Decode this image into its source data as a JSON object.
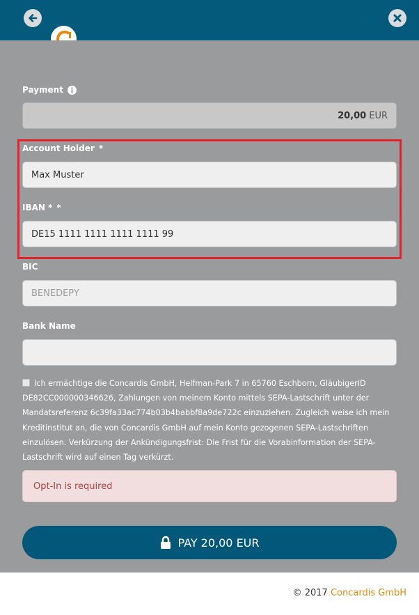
{
  "header": {
    "back_icon": "arrow-left-icon",
    "close_icon": "close-x-icon",
    "logo_icon": "concardis-logo-icon",
    "colors": {
      "header_bg": "#035a7a",
      "logo_accent": "#e58a0f"
    }
  },
  "form": {
    "payment_label": "Payment",
    "payment_amount": "20,00",
    "payment_currency": "EUR",
    "account_holder_label": "Account Holder",
    "account_holder_required": "*",
    "account_holder_value": "Max Muster",
    "iban_label": "IBAN *",
    "iban_required": "*",
    "iban_value": "DE15 1111 1111 1111 1111 99",
    "bic_label": "BIC",
    "bic_placeholder": "BENEDEPY",
    "bank_name_label": "Bank Name",
    "bank_name_value": ""
  },
  "consent": {
    "checked": false,
    "text": "Ich ermächtige die Concardis GmbH, Helfman-Park 7 in 65760 Eschborn, GläubigerID DE82CC000000346626, Zahlungen von meinem Konto mittels SEPA-Lastschrift unter der Mandatsreferenz 6c39fa33ac774b03b4babbf8a9de722c einzuziehen. Zugleich weise ich mein Kreditinstitut an, die von Concardis GmbH auf mein Konto gezogenen SEPA-Lastschriften einzulösen. Verkürzung der Ankündigungsfrist: Die Frist für die Vorabinformation der SEPA-Lastschrift wird auf einen Tag verkürzt."
  },
  "error": {
    "message": "Opt-In is required",
    "color": "#a94442"
  },
  "pay_button": {
    "label": "PAY 20,00 EUR",
    "icon": "lock-icon",
    "color": "#03587a"
  },
  "footer": {
    "copyright": "© 2017",
    "company": "Concardis GmbH"
  }
}
